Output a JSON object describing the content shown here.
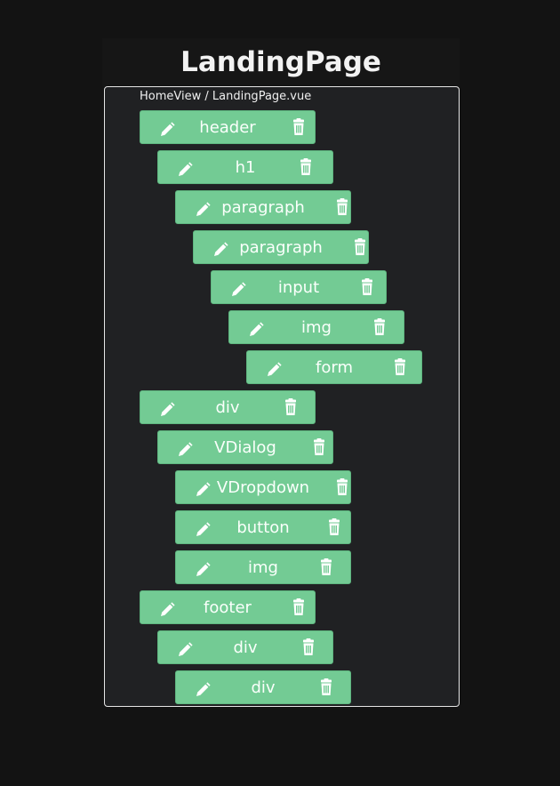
{
  "page": {
    "title": "LandingPage",
    "breadcrumb": "HomeView / LandingPage.vue"
  },
  "colors": {
    "background": "#131313",
    "panel": "#202123",
    "panel_border": "#e6e6e6",
    "node": "#73cb94",
    "node_text": "#fafffb"
  },
  "icons": {
    "edit": "pencil-icon",
    "delete": "trash-icon"
  },
  "tree": {
    "nodes": [
      {
        "label": "header",
        "depth": 0
      },
      {
        "label": "h1",
        "depth": 1
      },
      {
        "label": "paragraph",
        "depth": 2
      },
      {
        "label": "paragraph",
        "depth": 3
      },
      {
        "label": "input",
        "depth": 4
      },
      {
        "label": "img",
        "depth": 5
      },
      {
        "label": "form",
        "depth": 6
      },
      {
        "label": "div",
        "depth": 0
      },
      {
        "label": "VDialog",
        "depth": 1
      },
      {
        "label": "VDropdown",
        "depth": 2
      },
      {
        "label": "button",
        "depth": 2
      },
      {
        "label": "img",
        "depth": 2
      },
      {
        "label": "footer",
        "depth": 0
      },
      {
        "label": "div",
        "depth": 1
      },
      {
        "label": "div",
        "depth": 2
      }
    ]
  }
}
